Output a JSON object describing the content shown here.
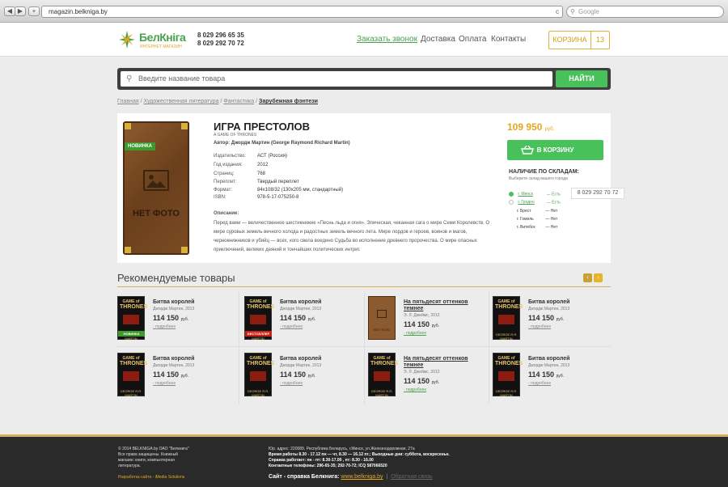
{
  "browser": {
    "url": "magazin.belkniga.by",
    "search_placeholder": "Google",
    "back": "◀",
    "forward": "▶",
    "add": "+",
    "reload": "c"
  },
  "header": {
    "logo_main": "БелКніга",
    "logo_sub": "ИНТЕРНЕТ МАГАЗИН",
    "phone1": "8 029 296 65 35",
    "phone2": "8 029 292 70 72",
    "nav": [
      "Заказать звонок",
      "Доставка",
      "Оплата",
      "Контакты"
    ],
    "cart_label": "КОРЗИНА",
    "cart_count": "13"
  },
  "search": {
    "placeholder": "Введите название товара",
    "button": "НАЙТИ"
  },
  "breadcrumb": {
    "items": [
      "Главная",
      "Художественная литература",
      "Фантастика"
    ],
    "current": "Зарубежная фэнтези"
  },
  "product": {
    "badge": "НОВИНКА",
    "no_photo": "НЕТ ФОТО",
    "title": "ИГРА ПРЕСТОЛОВ",
    "subtitle": "A GAME OF THRONES",
    "author": "Автор: Джордж Мартин (George Raymond Richard Martin)",
    "specs": [
      {
        "label": "Издательство:",
        "value": "АСТ (Россия)"
      },
      {
        "label": "Год издания:",
        "value": "2012"
      },
      {
        "label": "Страниц:",
        "value": "768"
      },
      {
        "label": "Переплет:",
        "value": "Твердый переплет"
      },
      {
        "label": "Формат:",
        "value": "84x108/32 (130x205 мм, стандартный)"
      },
      {
        "label": "ISBN:",
        "value": "978-5-17-075250-8"
      }
    ],
    "desc_title": "Описание:",
    "description": "Перед вами — величественное шестикнижие «Песнь льда и огня». Эпическая, чеканная сага о мире Семи Королевств. О мире суровых земель вечного холода и радостных земель вечного лета. Мире лордов и героев, воинов и магов, чернокнижников и убийц — всех, кого свела воедино Судьба во исполнение древнего пророчества. О мире опасных приключений, великих деяний и тончайших политических интриг.",
    "price": "109 950",
    "currency": "руб.",
    "buy_button": "В КОРЗИНУ",
    "stock_title": "НАЛИЧИЕ ПО СКЛАДАМ:",
    "stock_sub": "Выберите склад вашего города",
    "stores": [
      {
        "city": "г. Минск",
        "status": "— Есть"
      },
      {
        "city": "г. Гродно",
        "status": "— Есть"
      },
      {
        "city": "г. Брест",
        "status": "— Нет"
      },
      {
        "city": "г. Гомель",
        "status": "— Нет"
      },
      {
        "city": "г. Витебск",
        "status": "— Нет"
      }
    ],
    "store_phone": "8 029 292 70 72"
  },
  "recommended": {
    "title": "Рекомендуемые товары",
    "prev": "‹",
    "next": "›",
    "items": [
      {
        "name": "Битва королей",
        "author": "Джордж Мартин, 2013",
        "price": "114 150",
        "currency": "руб.",
        "more": "подробнее",
        "badge": "НОВИНКА",
        "cover": "got"
      },
      {
        "name": "Битва королей",
        "author": "Джордж Мартин, 2013",
        "price": "114 150",
        "currency": "руб.",
        "more": "подробнее",
        "badge": "БЕСТСЕЛЛЕР",
        "cover": "got"
      },
      {
        "name": "На пятьдесят оттенков темнее",
        "author": "Э. Л. Джеймс, 2012",
        "price": "114 150",
        "currency": "руб.",
        "more": "подробнее",
        "badge": "",
        "cover": "none"
      },
      {
        "name": "Битва королей",
        "author": "Джордж Мартин, 2013",
        "price": "114 150",
        "currency": "руб.",
        "more": "подробнее",
        "badge": "",
        "cover": "got"
      },
      {
        "name": "Битва королей",
        "author": "Джордж Мартин, 2013",
        "price": "114 150",
        "currency": "руб.",
        "more": "подробнее",
        "badge": "",
        "cover": "got"
      },
      {
        "name": "Битва королей",
        "author": "Джордж Мартин, 2013",
        "price": "114 150",
        "currency": "руб.",
        "more": "подробнее",
        "badge": "",
        "cover": "got"
      },
      {
        "name": "На пятьдесят оттенков темнее",
        "author": "Э. Л. Джеймс, 2012",
        "price": "114 150",
        "currency": "руб.",
        "more": "подробнее",
        "badge": "",
        "cover": "got"
      },
      {
        "name": "Битва королей",
        "author": "Джордж Мартин, 2013",
        "price": "114 150",
        "currency": "руб.",
        "more": "подробнее",
        "badge": "",
        "cover": "got"
      }
    ],
    "cover_text": {
      "game": "GAME of",
      "thrones": "THRONES",
      "author": "GEORGE R.R. MARTIN",
      "nofoto": "НЕТ ФОТО"
    }
  },
  "footer": {
    "copyright": "© 2014  BELKNIGA.by   ОАО \"Белкнига\"",
    "rights": "Все права защищены. Книжный",
    "rights2": "магазин: книги, компьютерная",
    "rights3": "литература.",
    "dev": "Разработка сайта - iMedia Solutions",
    "address": "Юр. адрес: 220089, Республика Беларусь, г.Минск, ул.Железнодорожная, 27а",
    "hours": "Время работы 8.30 - 17.12 пн — чт, 8.30 — 16.12 пт.; Выходные дни: суббота, воскресенье.",
    "help_hours": "Справка работает: пн - пт: 8.30-17.00 , пт: 8.30 - 16.00",
    "contacts": "Контактные телефоны: 296-65-35; 292-70-72; ICQ 587066520",
    "site_help": "Сайт - справка Белкнига:",
    "site_link": "www.belkniga.by",
    "feedback": "Обратная связь"
  },
  "colors": {
    "green": "#48c15a",
    "gold": "#e3a81c",
    "dark": "#2a2a2a"
  }
}
